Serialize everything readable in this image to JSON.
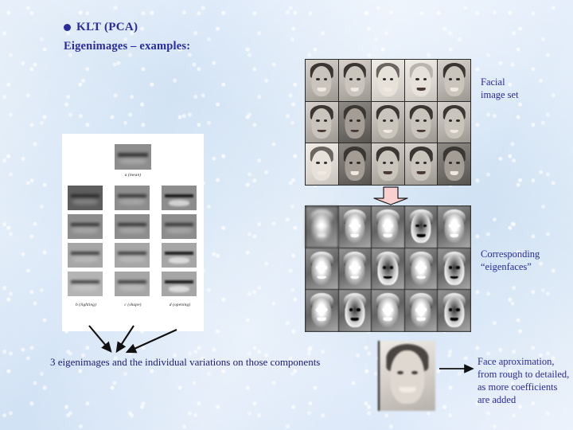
{
  "slide": {
    "background_color": "#dce9f7",
    "text_color": "#2b2b9e",
    "title": "KLT (PCA)",
    "subtitle": "Eigenimages – examples:"
  },
  "labels": {
    "facial_image_set": "Facial\nimage set",
    "facial_image_set_line1": "Facial",
    "facial_image_set_line2": "image set",
    "eigenfaces_line1": "Corresponding",
    "eigenfaces_line2": "“eigenfaces”",
    "approximation": "Face aproximation, from rough to detailed, as more coefficients are added",
    "caption": "3 eigenimages and the individual variations on those components"
  },
  "mouth_panel": {
    "mean_label": "a (mean)",
    "column_labels": [
      "b (lighting)",
      "c (shape)",
      "d (opening)"
    ],
    "rows": 4,
    "columns": 3,
    "panel_color": "#ffffff"
  },
  "facial_image_set": {
    "rows": 3,
    "columns": 5,
    "count": 15,
    "border_color": "#2a2a2a"
  },
  "eigenfaces": {
    "rows": 3,
    "columns": 5,
    "count": 15,
    "border_color": "#2a2a2a"
  },
  "shapes": {
    "down_arrow_fill": "#f9cfcf",
    "down_arrow_outline": "#1a1a1a",
    "pointer_arrow_color": "#111111"
  }
}
